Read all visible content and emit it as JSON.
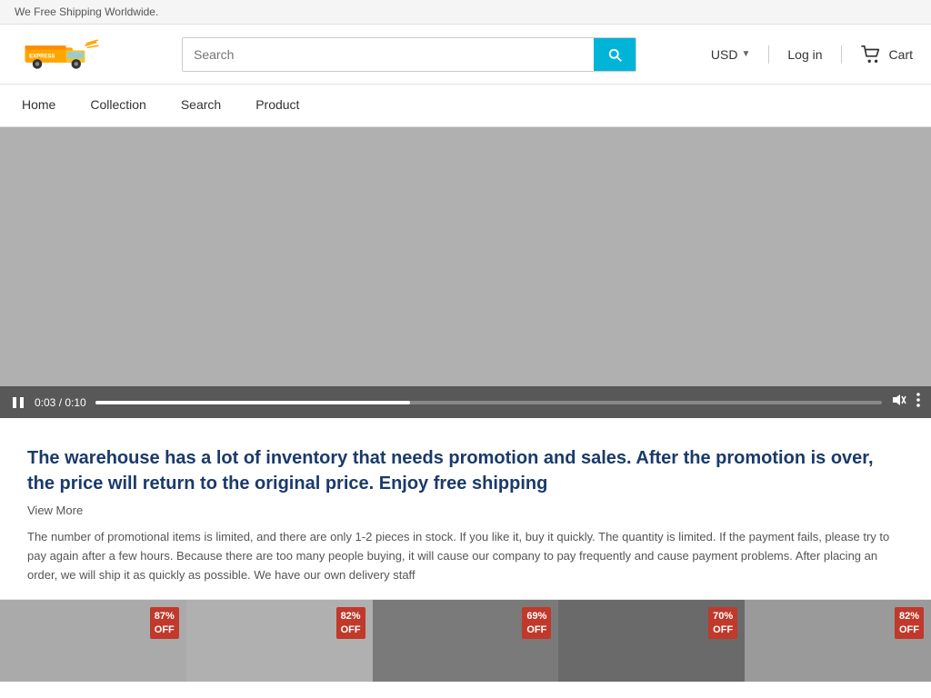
{
  "topbar": {
    "message": "We Free Shipping Worldwide."
  },
  "header": {
    "logo_alt": "Express Truck Logo",
    "search_placeholder": "Search",
    "search_button_label": "Search",
    "currency": "USD",
    "login_label": "Log in",
    "cart_label": "Cart"
  },
  "nav": {
    "items": [
      {
        "label": "Home",
        "id": "home"
      },
      {
        "label": "Collection",
        "id": "collection"
      },
      {
        "label": "Search",
        "id": "search"
      },
      {
        "label": "Product",
        "id": "product"
      }
    ]
  },
  "video": {
    "time_current": "0:03",
    "time_total": "0:10",
    "time_display": "0:03 / 0:10",
    "progress_percent": 40
  },
  "promo": {
    "heading": "The warehouse has a lot of inventory that needs promotion and sales. After the promotion is over, the price will return to the original price. Enjoy free shipping",
    "view_more": "View More",
    "body_text": "The number of promotional items is limited, and there are only 1-2 pieces in stock. If you like it, buy it quickly. The quantity is limited. If the payment fails, please try to pay again after a few hours. Because there are too many people buying, it will cause our company to pay frequently and cause payment problems. After placing an order, we will ship it as quickly as possible. We have our own delivery staff"
  },
  "products": [
    {
      "discount": "87%\nOFF"
    },
    {
      "discount": "82%\nOFF"
    },
    {
      "discount": "69%\nOFF"
    },
    {
      "discount": "70%\nOFF"
    },
    {
      "discount": "82%\nOFF"
    }
  ]
}
